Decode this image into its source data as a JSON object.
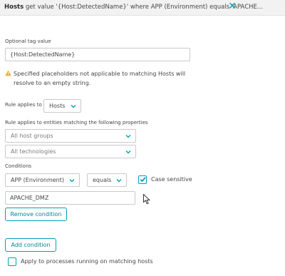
{
  "header": {
    "entity": "Hosts",
    "text_a": "get value '{Host:DetectedName}' where",
    "text_b": "APP (Environment)",
    "text_c": "equals 'APACHE...",
    "close_icon": "close-icon"
  },
  "tag_value": {
    "label": "Optional tag value",
    "value": "{Host:DetectedName}"
  },
  "warning": {
    "icon": "warning-icon",
    "text": "Specified placeholders not applicable to matching Hosts will resolve to an empty string."
  },
  "rule_applies": {
    "label": "Rule applies to",
    "selected": "Hosts"
  },
  "entities": {
    "label": "Rule applies to entities matching the following properties",
    "host_groups": "All host groups",
    "technologies": "All technologies"
  },
  "conditions": {
    "label": "Conditions",
    "key": "APP (Environment)",
    "operator": "equals",
    "case_sensitive_label": "Case sensitive",
    "case_sensitive": true,
    "value": "APACHE_DMZ",
    "remove_label": "Remove condition",
    "add_label": "Add condition"
  },
  "processes": {
    "label": "Apply to processes running on matching hosts",
    "checked": false
  },
  "colors": {
    "accent": "#00a1b2",
    "text": "#454646",
    "warning": "#f5a623"
  }
}
